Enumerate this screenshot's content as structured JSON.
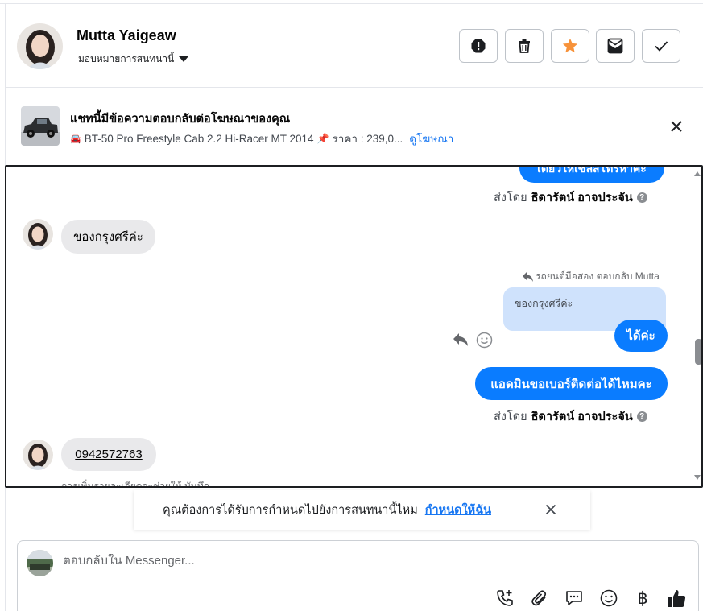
{
  "header": {
    "contact_name": "Mutta Yaigeaw",
    "assign_label": "มอบหมายการสนทนานี้",
    "actions": [
      "spam-icon",
      "trash-icon",
      "star-icon",
      "inbox-icon",
      "check-icon"
    ],
    "star_color": "#f7923a"
  },
  "ad_banner": {
    "title": "แชทนี้มีข้อความตอบกลับต่อโฆษณาของคุณ",
    "car_emoji": "🚘",
    "car_text": "BT-50 Pro Freestyle Cab 2.2 Hi-Racer MT 2014",
    "pin_emoji": "📌",
    "price_text": "ราคา : 239,0...",
    "link_text": "ดูโฆษณา"
  },
  "chat": {
    "top_bubble": "เดี๋ยวให้เซลส์โทรหาค่ะ",
    "sent_by_1": {
      "prefix": "ส่งโดย",
      "name": "ธิดารัตน์ อาจประจัน"
    },
    "incoming_1": "ของกรุงศรีค่ะ",
    "reply_label": "รถยนต์มือสอง ตอบกลับ Mutta",
    "quoted_text": "ของกรุงศรีค่ะ",
    "outgoing_reply": "ได้ค่ะ",
    "outgoing_2": "แอดมินขอเบอร์ติดต่อได้ไหมคะ",
    "sent_by_2": {
      "prefix": "ส่งโดย",
      "name": "ธิดารัตน์ อาจประจัน"
    },
    "incoming_phone": "0942572763",
    "cut_text": "การเพิ่มรายละเอียดจะช่วยให้ บันทึก",
    "accent_color": "#0a7cff"
  },
  "assign_prompt": {
    "text": "คุณต้องการได้รับการกำหนดไปยังการสนทนานี้ไหม",
    "link": "กำหนดให้ฉัน"
  },
  "composer": {
    "placeholder": "ตอบกลับใน Messenger...",
    "currency_symbol": "฿",
    "icons": [
      "call-add-icon",
      "attachment-icon",
      "saved-reply-icon",
      "emoji-icon",
      "currency-icon",
      "like-icon"
    ]
  }
}
